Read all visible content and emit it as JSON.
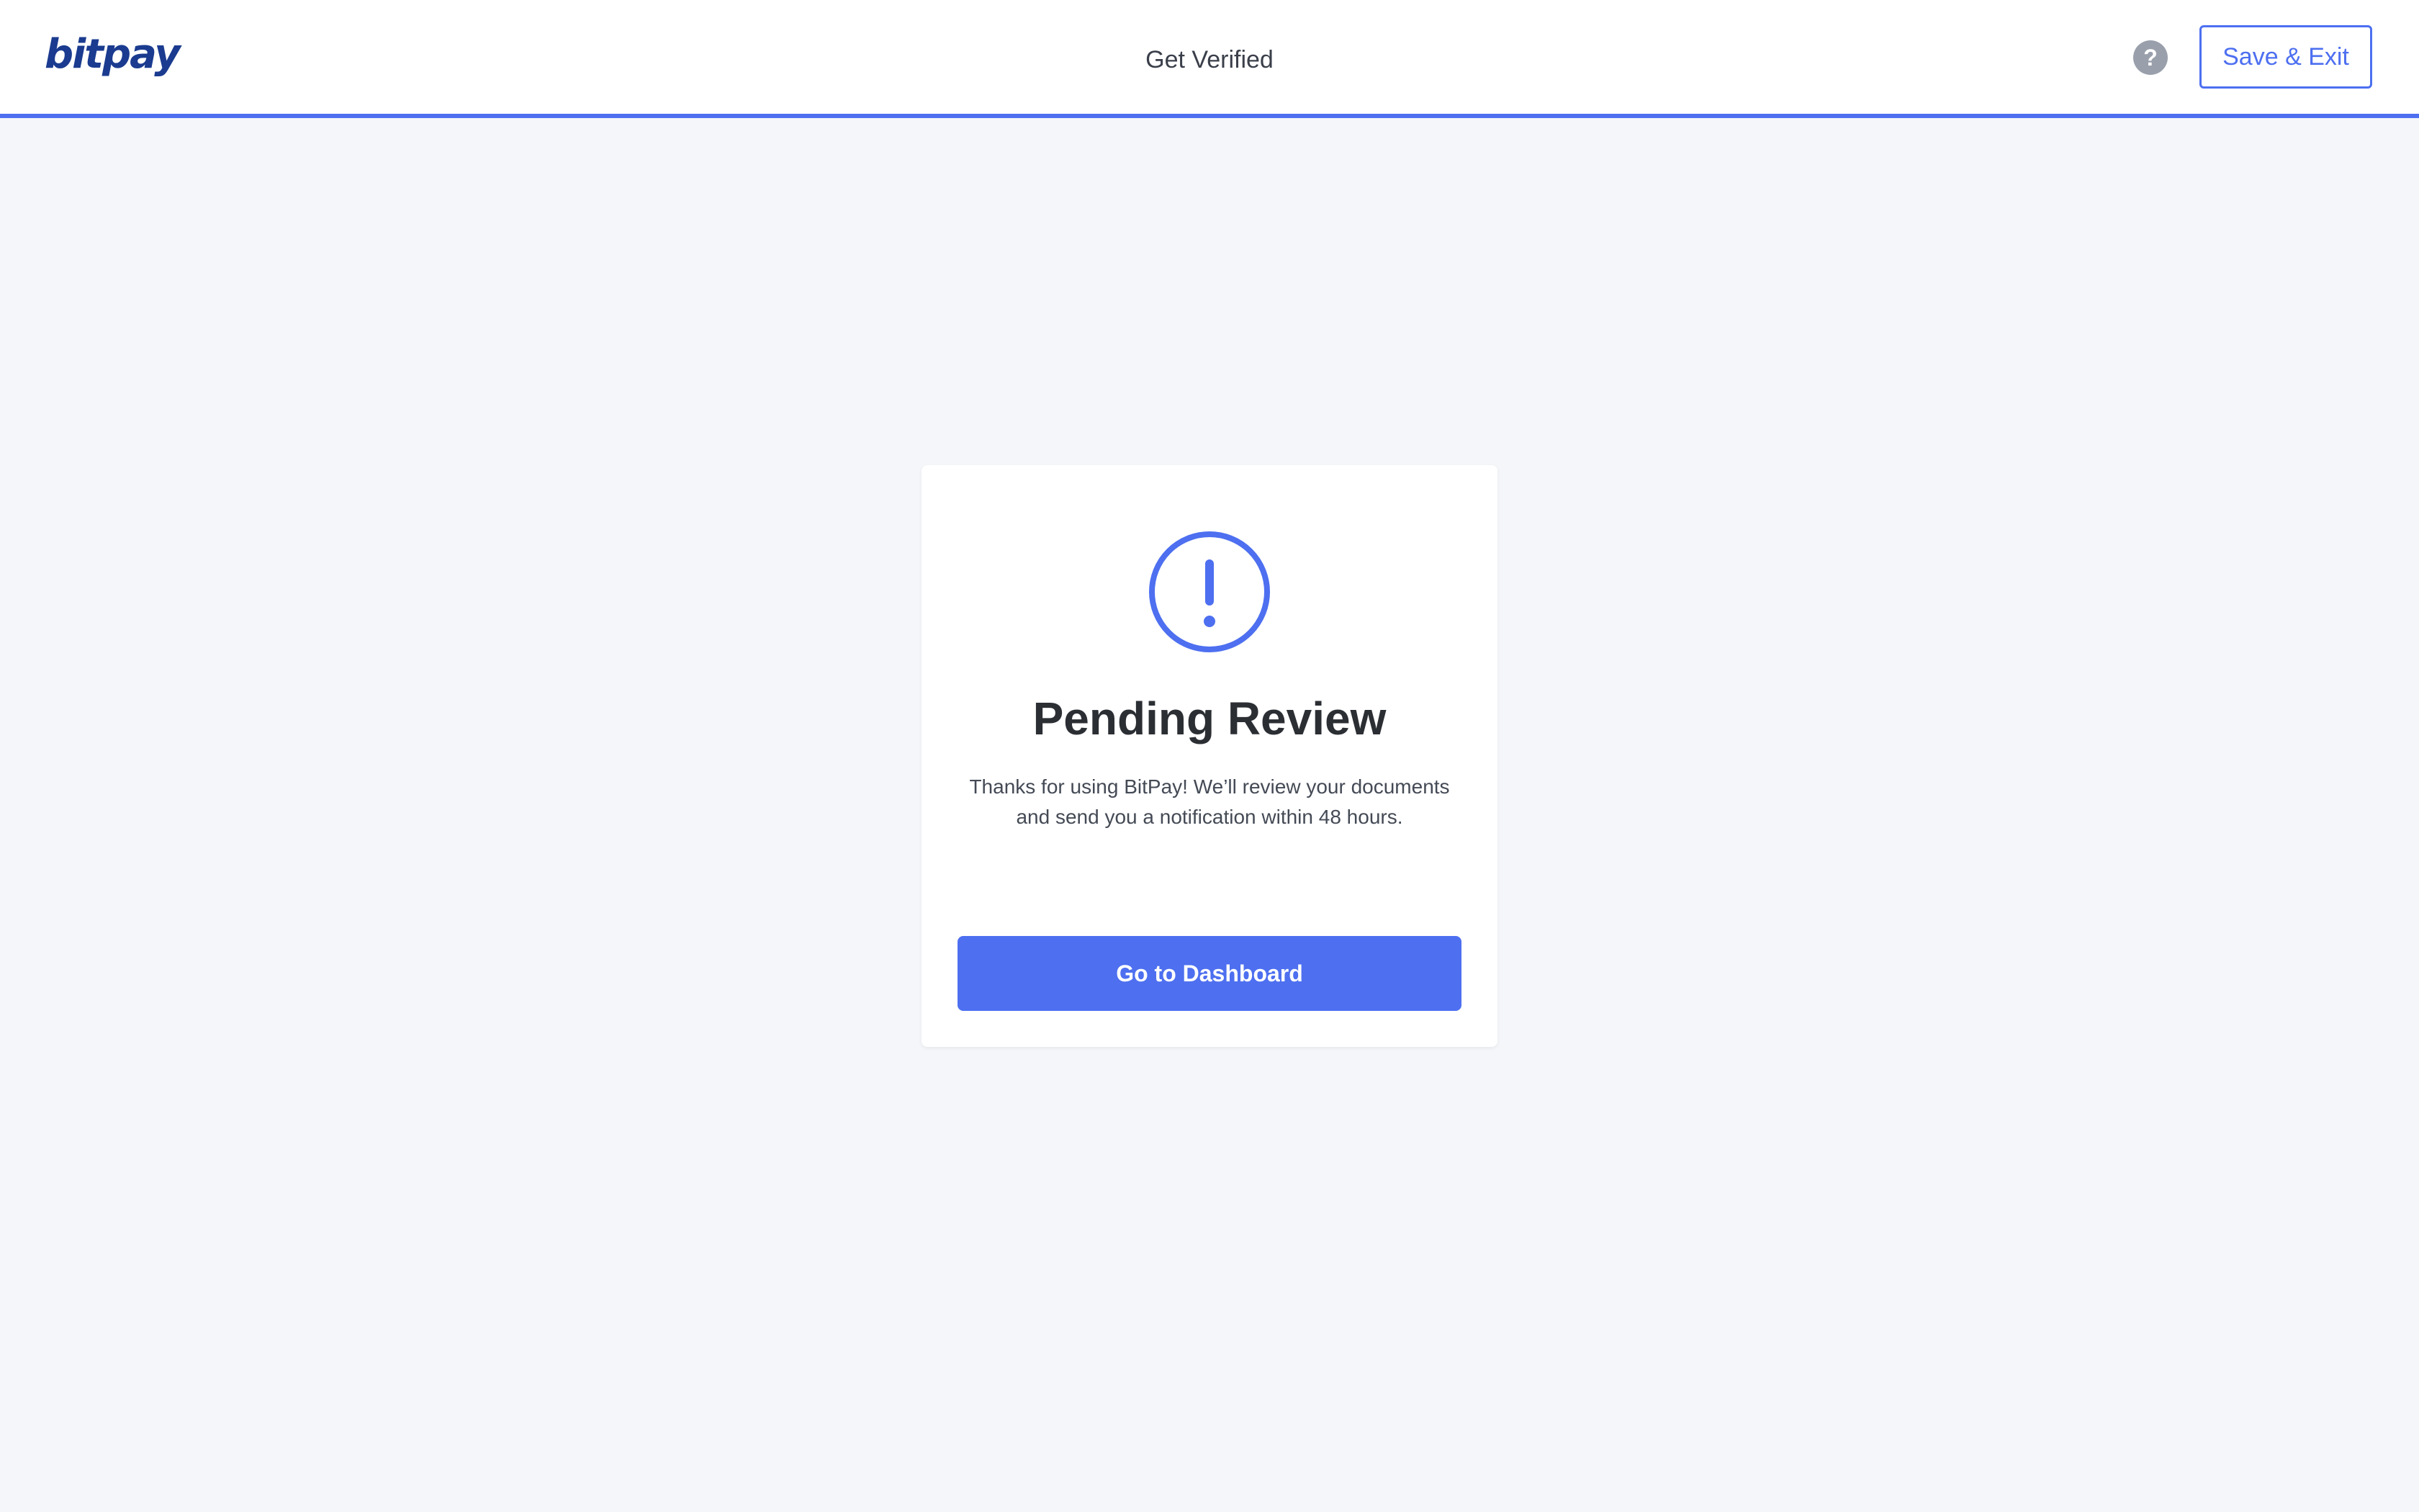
{
  "header": {
    "logo_text": "bitpay",
    "title": "Get Verified",
    "help_icon": "question-circle-icon",
    "help_glyph": "?",
    "save_exit_label": "Save & Exit"
  },
  "card": {
    "icon": "exclamation-circle-icon",
    "title": "Pending Review",
    "description_lines": [
      "Thanks for using BitPay! We’ll review your documents",
      "and send you a notification within 48 hours."
    ],
    "button_label": "Go to Dashboard"
  },
  "colors": {
    "accent": "#4d6ff0",
    "logo": "#1a3b8f",
    "background": "#f4f6fa",
    "help_icon": "#9aa0ab",
    "title_text": "#2b2e33"
  }
}
